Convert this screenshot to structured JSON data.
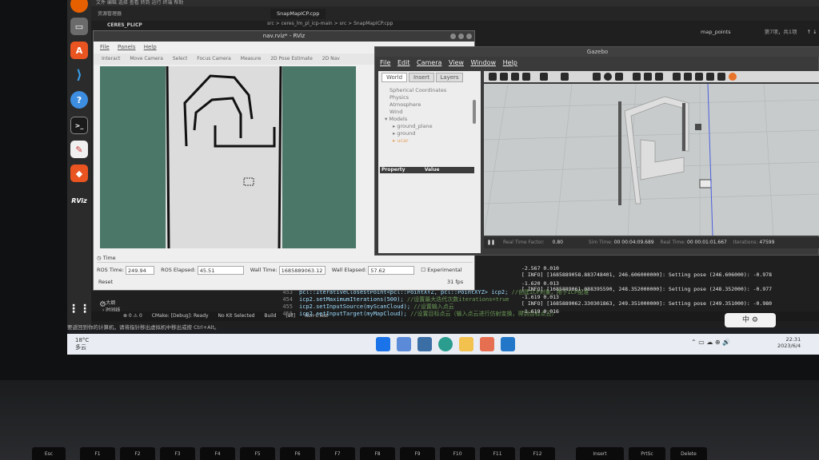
{
  "dock": {
    "items": [
      "firefox",
      "files",
      "software",
      "vscode",
      "help",
      "terminal",
      "text-editor",
      "layers",
      "rviz"
    ],
    "rviz_label": "RViz"
  },
  "vscode": {
    "menu": "文件  编辑  选择  查看  转到  运行  终端  帮助",
    "explorer_title": "资源管理器",
    "project": "CERES_PLICP",
    "tab": "SnapMapICP.cpp",
    "breadcrumb": "src > ceres_lm_pl_icp-main > src > SnapMapICP.cpp",
    "find_query": "map_points",
    "find_count": "第7项，共1项",
    "code": [
      {
        "no": "453",
        "text": "pcl::IterativeClosestPoint<pcl::PointXYZ, pcl::PointXYZ> icp2;",
        "comment": "//创建ICP对象，用于ICP配准"
      },
      {
        "no": "454",
        "text": "icp2.setMaximumIterations(500);",
        "comment": "//设置最大迭代次数iterations=true"
      },
      {
        "no": "455",
        "text": "icp2.setInputSource(myScanCloud);",
        "comment": "//设置输入点云"
      },
      {
        "no": "456",
        "text": "icp2.setInputTarget(myMapCloud);",
        "comment": "//设置目标点云（输入点云进行仿射变换，得到目标点云）"
      }
    ],
    "outline": [
      "大纲",
      "时间线"
    ],
    "status": {
      "errors": "⊗ 0 ⚠ 0",
      "cmake": "CMake: [Debug]: Ready",
      "kit": "No Kit Selected",
      "build": "Build",
      "all": "[all]",
      "run": "Run CTest"
    },
    "notification": "要返回到你的计算机，请将指针移出虚拟机中移出或按 Ctrl+Alt。"
  },
  "terminal": [
    "-2.567 0.010",
    "[ INFO] [1685889058.883748401, 246.606000000]: Setting pose (246.606000): -0.978",
    "-1.620 0.013",
    "[ INFO] [1685889061.088395590, 248.352000000]: Setting pose (248.352000): -0.977",
    "-1.619 0.013",
    "[ INFO] [1685889062.330301863, 249.351000000]: Setting pose (249.351000): -0.980",
    "-1.619 0.016"
  ],
  "rviz": {
    "title": "nav.rviz* - RViz",
    "menu": [
      "File",
      "Panels",
      "Help"
    ],
    "tools": [
      "Interact",
      "Move Camera",
      "Select",
      "Focus Camera",
      "Measure",
      "2D Pose Estimate",
      "2D Nav"
    ],
    "time_panel": "Time",
    "ros_time_label": "ROS Time:",
    "ros_time": "249.94",
    "ros_elapsed_label": "ROS Elapsed:",
    "ros_elapsed": "45.51",
    "wall_time_label": "Wall Time:",
    "wall_time": "1685889063.12",
    "wall_elapsed_label": "Wall Elapsed:",
    "wall_elapsed": "57.62",
    "experimental": "Experimental",
    "reset": "Reset",
    "fps": "31 fps",
    "colors": {
      "background": "#4a7768",
      "map_free": "#dcdcdc",
      "wall": "#111111"
    }
  },
  "gazebo": {
    "title": "Gazebo",
    "menu": [
      "File",
      "Edit",
      "Camera",
      "View",
      "Window",
      "Help"
    ],
    "tabs": [
      "World",
      "Insert",
      "Layers"
    ],
    "tree": [
      "Spherical Coordinates",
      "Physics",
      "Atmosphere",
      "Wind",
      "Models",
      "ground_plane",
      "ground",
      "ucar"
    ],
    "property_col": "Property",
    "value_col": "Value",
    "rtf_label": "Real Time Factor:",
    "rtf": "0.80",
    "sim_time_label": "Sim Time:",
    "sim_time": "00 00:04:09.689",
    "real_time_label": "Real Time:",
    "real_time": "00 00:01:01.667",
    "iterations_label": "Iterations:",
    "iterations": "47599",
    "colors": {
      "scene": "#c7cbcb",
      "walls": "#dedede"
    }
  },
  "taskbar": {
    "weather_temp": "18°C",
    "weather_desc": "多云",
    "time": "22:31",
    "date": "2023/6/4",
    "ime": "中"
  },
  "keyboard": [
    "Esc",
    "F1",
    "F2",
    "F3",
    "F4",
    "F5",
    "F6",
    "F7",
    "F8",
    "F9",
    "F10",
    "F11",
    "F12",
    "Insert",
    "PrtSc",
    "Delete"
  ]
}
